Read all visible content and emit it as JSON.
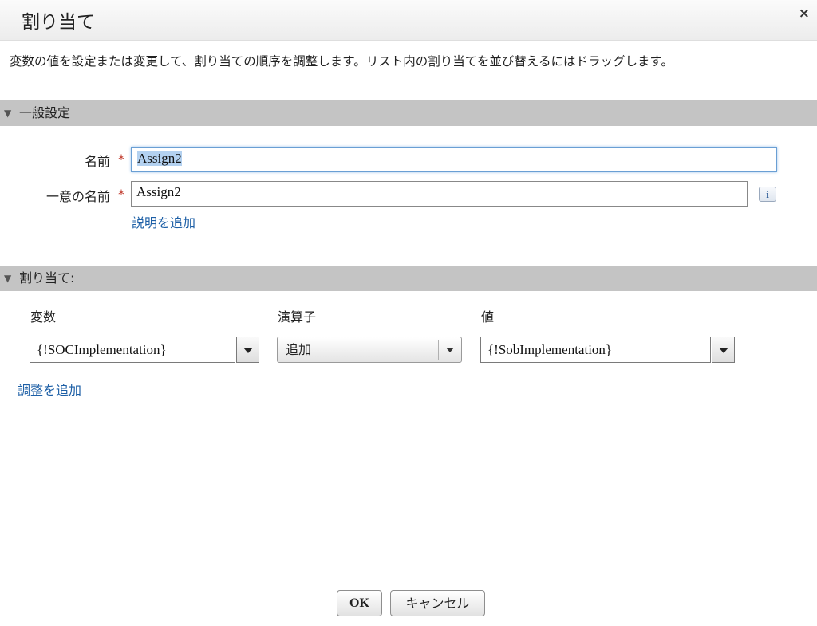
{
  "dialog": {
    "title": "割り当て",
    "close_label": "×",
    "description": "変数の値を設定または変更して、割り当ての順序を調整します。リスト内の割り当てを並び替えるにはドラッグします。"
  },
  "general": {
    "section_title": "一般設定",
    "name_label": "名前",
    "name_value": "Assign2",
    "unique_name_label": "一意の名前",
    "unique_name_value": "Assign2",
    "required_mark": "*",
    "info_label": "i",
    "add_description_link": "説明を追加"
  },
  "assignments": {
    "section_title": "割り当て:",
    "headers": {
      "variable": "変数",
      "operator": "演算子",
      "value": "値"
    },
    "row": {
      "variable": "{!SOCImplementation}",
      "operator": "追加",
      "value": "{!SobImplementation}"
    },
    "add_row_link": "調整を追加"
  },
  "footer": {
    "ok_label": "OK",
    "cancel_label": "キャンセル"
  }
}
